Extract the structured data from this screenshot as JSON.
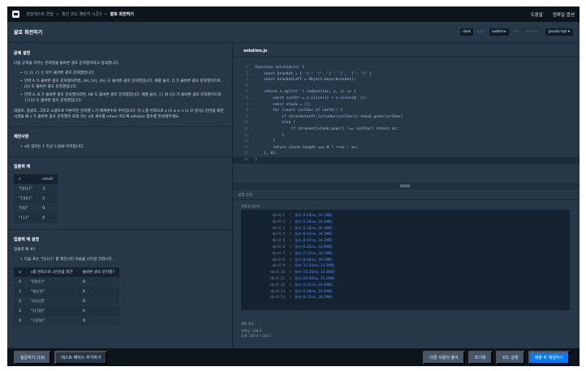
{
  "nav": {
    "crumbs": [
      "코딩테스트 연습",
      "월간 코드 챌린지 시즌2",
      "괄호 회전하기"
    ],
    "help": "도움말",
    "compile_options": "컴파일 옵션"
  },
  "header": {
    "title": "괄호 회전하기",
    "themes": [
      "dark",
      "light",
      "sublime",
      "vim",
      "emacs"
    ],
    "active_themes": [
      "dark",
      "sublime"
    ],
    "language": "JavaScript ▾"
  },
  "problem": {
    "desc_title": "문제 설명",
    "intro": "다음 규칙을 지키는 문자열을 올바른 괄호 문자열이라고 정의합니다.",
    "rules": [
      "(), [], {} 는 모두 올바른 괄호 문자열입니다.",
      "만약 A 가 올바른 괄호 문자열이라면, (A), [A], {A} 도 올바른 괄호 문자열입니다. 예를 들어, [] 가 올바른 괄호 문자열이므로, ([]) 도 올바른 괄호 문자열입니다.",
      "만약 A, B 가 올바른 괄호 문자열이라면, AB 도 올바른 괄호 문자열입니다. 예를 들어, {} 와 ([]) 가 올바른 괄호 문자열이므로, {}([]) 도 올바른 괄호 문자열입니다."
    ],
    "task": "대괄호, 중괄호, 그리고 소괄호로 이루어진 문자열 s 가 매개변수로 주어집니다. 이 s 를 왼쪽으로 x (0 ≤ x < (s 의 길이)) 칸만큼 회전시켰을 때 s 가 올바른 괄호 문자열이 되게 하는 x의 개수를 return 하도록 solution 함수를 완성해주세요.",
    "limits_title": "제한사항",
    "limits": [
      "s의 길이는 1 이상 1,000 이하입니다."
    ],
    "io_title": "입출력 예",
    "io_headers": [
      "s",
      "result"
    ],
    "io_rows": [
      [
        "\"[](){}\"",
        "3"
      ],
      [
        "\"}]()[{\"",
        "2"
      ],
      [
        "\"[)(]\"",
        "0"
      ],
      [
        "\"}}}\"",
        "0"
      ]
    ],
    "explain_title": "입출력 예 설명",
    "explain_sub": "입출력 예 #1",
    "explain_bullet": "다음 표는 \"[](){}\" 를 회전시킨 모습을 나타낸 것입니다.",
    "rot_headers": [
      "x",
      "s를 왼쪽으로 x칸만큼 회전",
      "올바른 괄호 문자열?"
    ],
    "rot_rows": [
      [
        "0",
        "\"[](){}\"",
        "O"
      ],
      [
        "1",
        "\"](){}[\"",
        "X"
      ],
      [
        "2",
        "\"(){}[]\"",
        "O"
      ],
      [
        "3",
        "\"){}[](\"",
        "X"
      ],
      [
        "4",
        "\"{}[]()\"",
        "O"
      ]
    ]
  },
  "editor": {
    "filename": "solution.js",
    "lines": [
      "function solution(s) {",
      "    const bracket = { '(': ')', '[': ']', '{': '}' }",
      "    const bracketLeft = Object.keys(bracket);",
      "",
      "    return s.split('').reduce((ac, v, i) => {",
      "        const curStr = s.slice(i) + s.slice(0, i);",
      "        const stack = [];",
      "        for (const curChar of curStr) {",
      "            if (bracketLeft.includes(curChar)) stack.push(curChar)",
      "            else {",
      "                if (bracket[stack.pop()] !== curChar) return ac;",
      "            }",
      "        }",
      "        return stack.length === 0 ? ++ac : ac;",
      "    }, 0);",
      "}"
    ]
  },
  "results": {
    "title": "실행 결과",
    "subtitle": "정확성  테스트",
    "rows": [
      [
        "테스트 1",
        "통과 (4.59ms, 34.1MB)"
      ],
      [
        "테스트 2",
        "통과 (5.10ms, 34.3MB)"
      ],
      [
        "테스트 3",
        "통과 (5.18ms, 34.3MB)"
      ],
      [
        "테스트 4",
        "통과 (6.43ms, 34.3MB)"
      ],
      [
        "테스트 5",
        "통과 (9.47ms, 34.3MB)"
      ],
      [
        "테스트 6",
        "통과 (6.25ms, 33.9MB)"
      ],
      [
        "테스트 7",
        "통과 (7.13ms, 34.2MB)"
      ],
      [
        "테스트 8",
        "통과 (8.88ms, 34.2MB)"
      ],
      [
        "테스트 9",
        "통과 (11.83ms, 34.3MB)"
      ],
      [
        "테스트 10",
        "통과 (15.28ms, 34.4MB)"
      ],
      [
        "테스트 11",
        "통과 (20.69ms, 35.2MB)"
      ],
      [
        "테스트 12",
        "통과 (0.35ms, 29.8MB)"
      ],
      [
        "테스트 13",
        "통과 (0.18ms, 29.9MB)"
      ],
      [
        "테스트 14",
        "통과 (0.12ms, 30.2MB)"
      ]
    ],
    "score_title": "채점 결과",
    "accuracy": "정확성: 100.0",
    "total": "합계: 100.0 / 100.0"
  },
  "bottom": {
    "question": "질문하기 (18)",
    "add_testcase": "테스트 케이스 추가하기",
    "others": "다른 사람의 풀이",
    "reset": "초기화",
    "run": "코드 실행",
    "submit": "제출 후 채점하기"
  }
}
